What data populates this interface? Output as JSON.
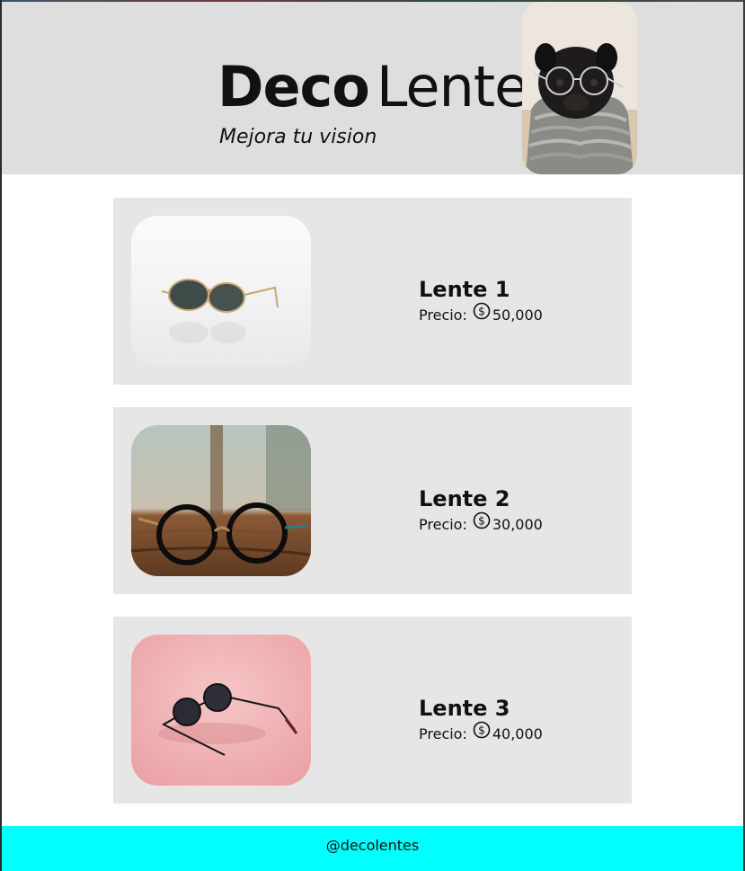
{
  "header": {
    "brand_bold": "Deco",
    "brand_light": "Lentes",
    "tagline": "Mejora tu vision",
    "bg_color": "#dedede"
  },
  "products": [
    {
      "name": "Lente 1",
      "price_label": "Precio:",
      "price": "50,000",
      "currency_icon": "dollar-coin-icon"
    },
    {
      "name": "Lente 2",
      "price_label": "Precio:",
      "price": "30,000",
      "currency_icon": "dollar-coin-icon"
    },
    {
      "name": "Lente 3",
      "price_label": "Precio:",
      "price": "40,000",
      "currency_icon": "dollar-coin-icon"
    }
  ],
  "footer": {
    "handle": "@decolentes",
    "bg_color": "#00ffff"
  },
  "colors": {
    "card_bg": "#e6e6e6",
    "page_bg": "#ffffff",
    "text": "#111111"
  }
}
